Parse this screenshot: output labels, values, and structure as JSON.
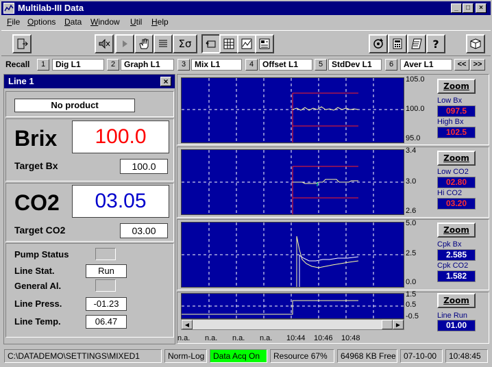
{
  "window": {
    "title": "Multilab-III Data"
  },
  "menu": [
    {
      "label": "File",
      "key": "F",
      "rest": "ile"
    },
    {
      "label": "Options",
      "key": "O",
      "rest": "ptions"
    },
    {
      "label": "Data",
      "key": "D",
      "rest": "ata"
    },
    {
      "label": "Window",
      "key": "W",
      "rest": "indow"
    },
    {
      "label": "Util",
      "key": "U",
      "rest": "til"
    },
    {
      "label": "Help",
      "key": "H",
      "rest": "elp"
    }
  ],
  "toolbar": {
    "sum_sigma": "Σσ",
    "help": "?"
  },
  "recall": {
    "label": "Recall",
    "slots": [
      {
        "num": "1",
        "name": "Dig L1"
      },
      {
        "num": "2",
        "name": "Graph L1"
      },
      {
        "num": "3",
        "name": "Mix L1"
      },
      {
        "num": "4",
        "name": "Offset L1"
      },
      {
        "num": "5",
        "name": "StdDev L1"
      },
      {
        "num": "6",
        "name": "Aver L1"
      }
    ],
    "prev": "<<",
    "next": ">>"
  },
  "line": {
    "title": "Line 1",
    "close": "×",
    "product": "No product",
    "brix_label": "Brix",
    "brix_value": "100.0",
    "target_bx_label": "Target Bx",
    "target_bx": "100.0",
    "co2_label": "CO2",
    "co2_value": "03.05",
    "target_co2_label": "Target CO2",
    "target_co2": "03.00",
    "pump_status_label": "Pump Status",
    "line_stat_label": "Line Stat.",
    "line_stat": "Run",
    "general_al_label": "General Al.",
    "line_press_label": "Line Press.",
    "line_press": "-01.23",
    "line_temp_label": "Line Temp.",
    "line_temp": "06.47"
  },
  "charts": {
    "zoom_label": "Zoom",
    "brix": {
      "y_top": "105.0",
      "y_mid": "100.0",
      "y_bot": "95.0",
      "low_label": "Low Bx",
      "low": "097.5",
      "high_label": "High Bx",
      "high": "102.5"
    },
    "co2": {
      "y_top": "3.4",
      "y_mid": "3.0",
      "y_bot": "2.6",
      "low_label": "Low CO2",
      "low": "02.80",
      "high_label": "Hi CO2",
      "high": "03.20"
    },
    "cpk": {
      "y_top": "5.0",
      "y_mid": "2.5",
      "y_bot": "0.0",
      "bx_label": "Cpk Bx",
      "bx": "2.585",
      "co2_label": "Cpk CO2",
      "co2": "1.582"
    },
    "run": {
      "y_top": "1.5",
      "y_mid": "0.5",
      "y_bot": "-0.5",
      "label": "Line Run",
      "value": "01.00"
    },
    "x_ticks": [
      "n.a.",
      "n.a.",
      "n.a.",
      "n.a.",
      "10:44",
      "10:46",
      "10:48"
    ],
    "scroll_left": "◀",
    "scroll_right": "▶"
  },
  "status": {
    "path": "C:\\DATADEMO\\SETTINGS\\MIXED1",
    "log": "Norm-Log",
    "acq": "Data Acq On",
    "resource": "Resource 67%",
    "mem": "64968 KB Free",
    "date": "07-10-00",
    "time": "10:48:45"
  },
  "colors": {
    "brix_value": "#ff0000",
    "co2_value": "#0000cc",
    "limit_value": "#ff3030",
    "plot_bg": "#0000a0",
    "acq_on": "#00ff00"
  }
}
